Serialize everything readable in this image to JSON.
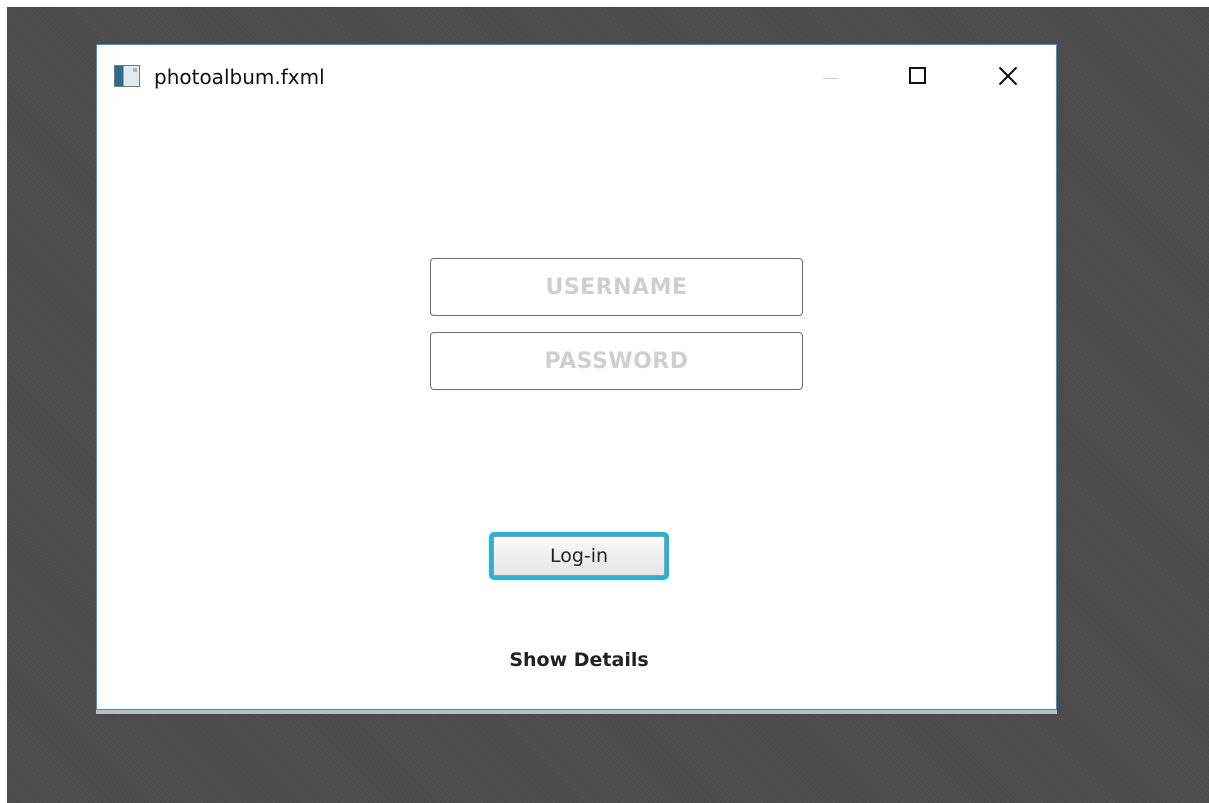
{
  "window": {
    "title": "photoalbum.fxml",
    "app_icon": "window-app-icon",
    "controls": {
      "minimize_icon": "minimize-icon",
      "maximize_icon": "maximize-icon",
      "close_icon": "close-icon"
    }
  },
  "login_form": {
    "username": {
      "placeholder": "USERNAME",
      "value": ""
    },
    "password": {
      "placeholder": "PASSWORD",
      "value": ""
    },
    "login_button_label": "Log-in",
    "show_details_label": "Show Details"
  },
  "colors": {
    "window_border": "#3c8fd6",
    "focus_ring": "#1eb7dc",
    "desktop_background": "#4a4a4a",
    "placeholder_text": "#cfcfcf"
  }
}
